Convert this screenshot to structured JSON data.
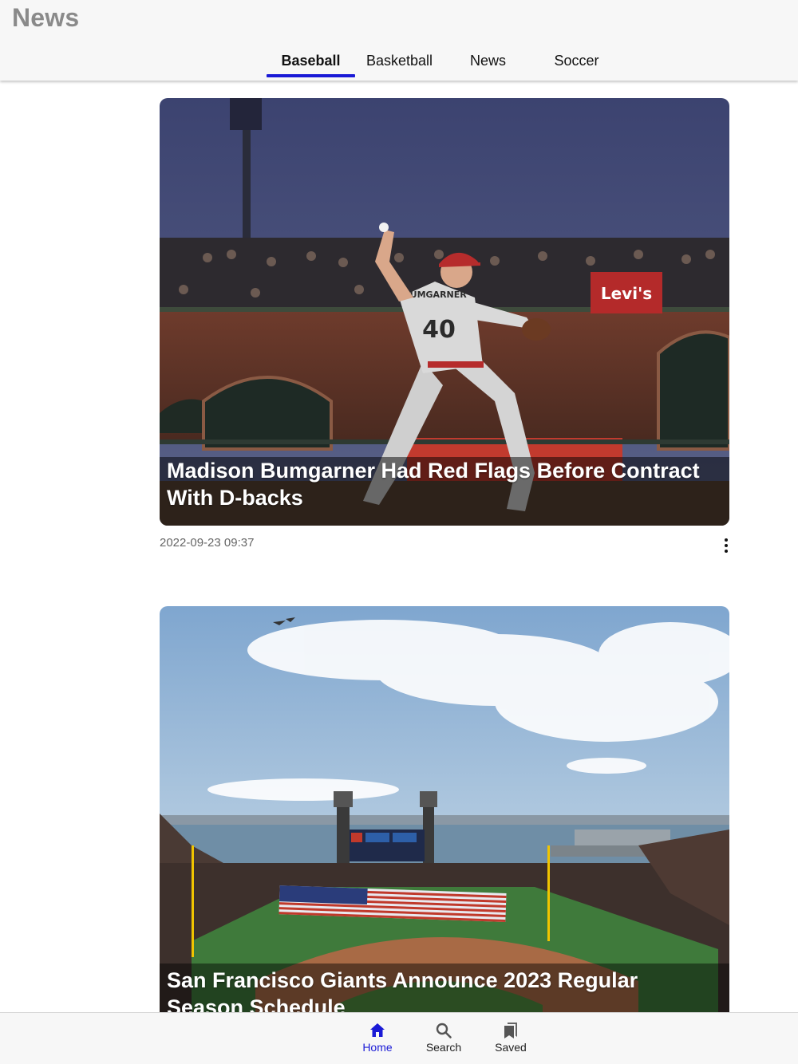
{
  "app": {
    "title": "News"
  },
  "tabs": [
    {
      "label": "Baseball",
      "active": true
    },
    {
      "label": "Basketball",
      "active": false
    },
    {
      "label": "News",
      "active": false
    },
    {
      "label": "Soccer",
      "active": false
    }
  ],
  "articles": [
    {
      "headline": "Madison Bumgarner Had Red Flags Before Contract With D-backs",
      "timestamp": "2022-09-23 09:37",
      "image_desc": "pitcher-photo"
    },
    {
      "headline": "San Francisco Giants Announce 2023 Regular Season Schedule",
      "timestamp": "",
      "image_desc": "ballpark-photo"
    }
  ],
  "image_text": {
    "banner": "Levi's",
    "jersey_name": "BUMGARNER",
    "jersey_number": "40"
  },
  "bottom_nav": [
    {
      "label": "Home",
      "icon": "home-icon",
      "active": true
    },
    {
      "label": "Search",
      "icon": "search-icon",
      "active": false
    },
    {
      "label": "Saved",
      "icon": "bookmark-icon",
      "active": false
    }
  ],
  "colors": {
    "accent": "#1a1ad6",
    "header_bg": "#f7f7f7",
    "title_gray": "#8a8a8a"
  }
}
